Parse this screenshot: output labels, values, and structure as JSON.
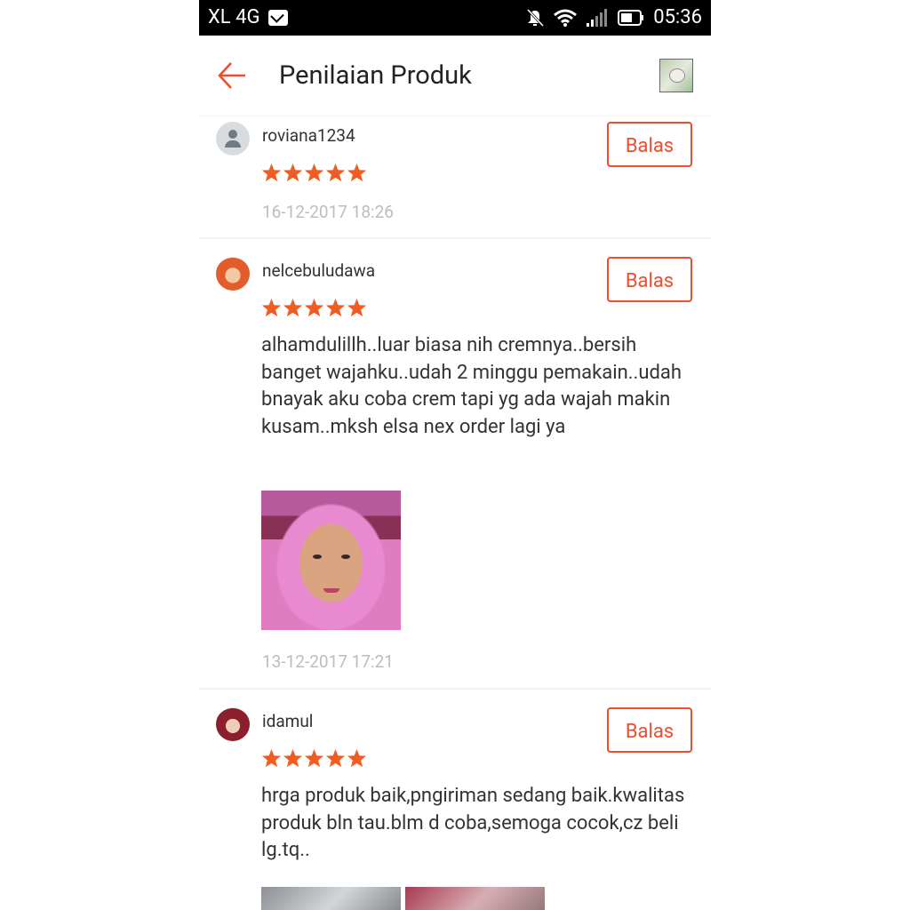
{
  "status_bar": {
    "carrier": "XL 4G",
    "time": "05:36"
  },
  "header": {
    "title": "Penilaian Produk"
  },
  "reviews": [
    {
      "username": "roviana1234",
      "rating": 5,
      "text": "",
      "date": "16-12-2017 18:26",
      "reply_label": "Balas"
    },
    {
      "username": "nelcebuludawa",
      "rating": 5,
      "text": "alhamdulillh..luar biasa nih cremnya..bersih banget wajahku..udah 2 minggu pemakain..udah bnayak aku coba crem tapi yg ada wajah makin kusam..mksh elsa nex order lagi ya",
      "date": "13-12-2017 17:21",
      "reply_label": "Balas"
    },
    {
      "username": "idamul",
      "rating": 5,
      "text": "hrga produk baik,pngiriman sedang baik.kwalitas produk bln tau.blm d coba,semoga cocok,cz beli lg.tq..",
      "date": "",
      "reply_label": "Balas"
    }
  ],
  "colors": {
    "accent": "#ee4d2d",
    "star": "#f05d23",
    "date_text": "#bdbdbd"
  },
  "icons": {
    "back": "arrow-left-icon",
    "star": "star-icon",
    "mail": "mail-icon",
    "silent": "bell-off-icon",
    "wifi": "wifi-icon",
    "signal": "signal-icon",
    "battery": "battery-icon"
  }
}
